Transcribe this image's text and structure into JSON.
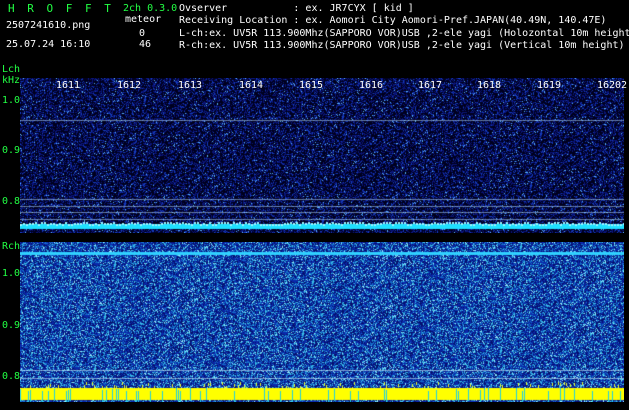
{
  "header": {
    "app_name": "H R O F F T",
    "version": "2ch 0.3.0",
    "filename": "2507241610.png",
    "datetime": "25.07.24 16:10",
    "meteor_label": "meteor",
    "lch_count": "0",
    "rch_count": "46",
    "observer_line": "Ovserver           : ex. JR7CYX [ kid ]",
    "location_line": "Receiving Location : ex. Aomori City Aomori-Pref.JAPAN(40.49N, 140.47E)",
    "lch_line": "L-ch:ex. UV5R 113.900Mhz(SAPPORO VOR)USB ,2-ele yagi (Holozontal 10m height)",
    "rch_line": "R-ch:ex. UV5R 113.900Mhz(SAPPORO VOR)USB ,2-ele yagi (Vertical 10m height)"
  },
  "lch": {
    "channel_label": "Lch",
    "unit_label": "kHz",
    "y_ticks": [
      "1.0",
      "0.9",
      "0.8"
    ]
  },
  "rch": {
    "channel_label": "Rch",
    "unit_label": "kHz",
    "y_ticks": [
      "1.0",
      "0.9",
      "0.8"
    ]
  },
  "time_ticks": [
    "1611",
    "1612",
    "1613",
    "1614",
    "1615",
    "1616",
    "1617",
    "1618",
    "1619",
    "1620",
    "2"
  ],
  "colors": {
    "background": "#000000",
    "label_green": "#22ff44",
    "noise_low": "#0a1a8a",
    "noise_high": "#7fe6ff",
    "yellow_band": "#ffff00",
    "cyan_band": "#20e0ff"
  }
}
